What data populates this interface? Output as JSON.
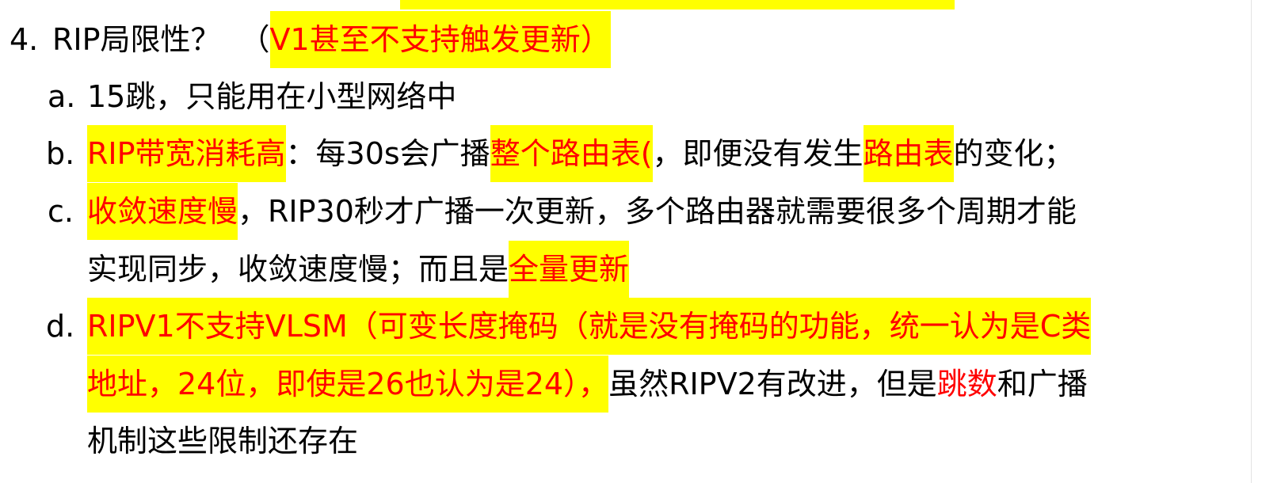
{
  "colors": {
    "highlight": "#ffff00",
    "emphasis": "#ff0000",
    "text": "#000000"
  },
  "heading": {
    "number": "4.",
    "text": "RIP局限性？",
    "paren_open": "（",
    "note": "V1甚至不支持触发更新）"
  },
  "items": {
    "a": {
      "marker": "a.",
      "text": "15跳，只能用在小型网络中"
    },
    "b": {
      "marker": "b.",
      "hl1": "RIP带宽消耗高",
      "t1": "：每30s会广播",
      "hl2": "整个路由表(",
      "t2": "，即便没有发生",
      "hl3": "路由表",
      "t3": "的变化；"
    },
    "c": {
      "marker": "c.",
      "hl1": "收敛速度慢",
      "t1": "，RIP30秒才广播一次更新，多个路由器就需要很多个周期才能",
      "t2": "实现同步，收敛速度慢；而且是",
      "hl2": "全量更新"
    },
    "d": {
      "marker": "d.",
      "hl1": "RIPV1不支持VLSM（可变长度掩码（就是没有掩码的功能，统一认为是C类",
      "hl2": "地址，24位，即使是26也认为是24），",
      "t1": "虽然RIPV2有改进，但是",
      "red1": "跳数",
      "t2": "和广播",
      "t3": "机制这些限制还存在"
    }
  }
}
